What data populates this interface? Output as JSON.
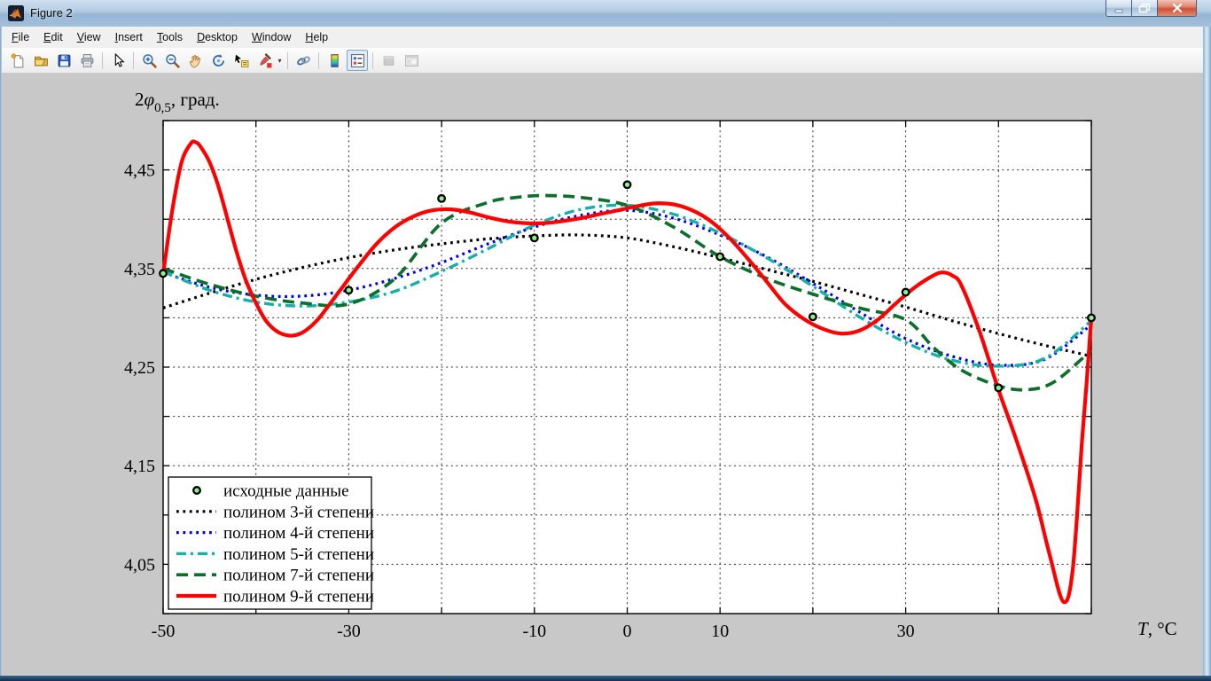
{
  "window": {
    "title": "Figure 2",
    "controls": {
      "minimize": "minimize",
      "restore": "restore-down",
      "close": "close"
    }
  },
  "menu": {
    "items": [
      "File",
      "Edit",
      "View",
      "Insert",
      "Tools",
      "Desktop",
      "Window",
      "Help"
    ]
  },
  "toolbar": {
    "icons": [
      "new-figure",
      "open-file",
      "save-figure",
      "print-figure",
      "edit-plot-cursor",
      "zoom-in",
      "zoom-out",
      "pan",
      "rotate-3d",
      "data-cursor",
      "brush-data",
      "link-plot",
      "insert-colorbar",
      "insert-legend",
      "hide-plot-tools",
      "show-plot-tools"
    ],
    "pressed": "insert-legend",
    "disabled": [
      "hide-plot-tools",
      "show-plot-tools"
    ]
  },
  "colors": {
    "figure_bg": "#c8c8c8",
    "plot_bg": "#ffffff",
    "titlebar": "#a9c4de"
  },
  "chart_data": {
    "type": "line",
    "title": "",
    "ylabel": {
      "base": "2",
      "symbol": "φ",
      "sub": "0,5",
      "rest": ", град."
    },
    "xlabel": {
      "symbol": "T",
      "rest": ", °C"
    },
    "xlim": [
      -50,
      50
    ],
    "ylim": [
      4.0,
      4.5
    ],
    "grid": true,
    "x_ticks": {
      "step": 10,
      "labels": [
        {
          "v": -50,
          "t": "-50"
        },
        {
          "v": -30,
          "t": "-30"
        },
        {
          "v": -10,
          "t": "-10"
        },
        {
          "v": 0,
          "t": "0"
        },
        {
          "v": 10,
          "t": "10"
        },
        {
          "v": 30,
          "t": "30"
        }
      ]
    },
    "y_ticks": {
      "step": 0.05,
      "labels": [
        {
          "v": 4.45,
          "t": "4,45"
        },
        {
          "v": 4.35,
          "t": "4,35"
        },
        {
          "v": 4.25,
          "t": "4,25"
        },
        {
          "v": 4.15,
          "t": "4,15"
        },
        {
          "v": 4.05,
          "t": "4,05"
        }
      ]
    },
    "legend_position": "southwest",
    "series": [
      {
        "name": "исходные данные",
        "type": "scatter",
        "color": "#000000",
        "face": "#8df08d",
        "style": "marker",
        "x": [
          -50,
          -30,
          -20,
          -10,
          0,
          10,
          20,
          30,
          40,
          50
        ],
        "y": [
          4.345,
          4.328,
          4.421,
          4.381,
          4.435,
          4.362,
          4.301,
          4.326,
          4.229,
          4.3
        ]
      },
      {
        "name": "полином 3-й степени",
        "type": "line",
        "color": "#000000",
        "style": "dotted",
        "x": [
          -50,
          -45,
          -40,
          -35,
          -30,
          -25,
          -20,
          -15,
          -10,
          -5,
          0,
          5,
          10,
          15,
          20,
          25,
          30,
          35,
          40,
          45,
          50
        ],
        "y": [
          4.31,
          4.325,
          4.339,
          4.351,
          4.361,
          4.369,
          4.375,
          4.38,
          4.383,
          4.384,
          4.381,
          4.372,
          4.361,
          4.349,
          4.337,
          4.324,
          4.311,
          4.297,
          4.284,
          4.272,
          4.261
        ]
      },
      {
        "name": "полином 4-й степени",
        "type": "line",
        "color": "#0000ee",
        "style": "dotted",
        "x": [
          -50,
          -45,
          -40,
          -35,
          -30,
          -25,
          -20,
          -15,
          -10,
          -5,
          0,
          5,
          10,
          15,
          20,
          25,
          30,
          35,
          40,
          45,
          50
        ],
        "y": [
          4.346,
          4.331,
          4.323,
          4.322,
          4.328,
          4.34,
          4.356,
          4.375,
          4.392,
          4.404,
          4.409,
          4.401,
          4.384,
          4.362,
          4.335,
          4.306,
          4.279,
          4.261,
          4.252,
          4.258,
          4.293
        ]
      },
      {
        "name": "полином 5-й степени",
        "type": "line",
        "color": "#17b0a8",
        "style": "dashdot",
        "x": [
          -50,
          -45,
          -40,
          -35,
          -30,
          -25,
          -20,
          -15,
          -10,
          -5,
          0,
          5,
          10,
          15,
          20,
          25,
          30,
          35,
          40,
          45,
          50
        ],
        "y": [
          4.347,
          4.328,
          4.316,
          4.312,
          4.316,
          4.327,
          4.347,
          4.37,
          4.394,
          4.41,
          4.414,
          4.405,
          4.386,
          4.361,
          4.332,
          4.301,
          4.275,
          4.257,
          4.251,
          4.259,
          4.297
        ]
      },
      {
        "name": "полином 7-й степени",
        "type": "line",
        "color": "#0e6f2d",
        "style": "dashed",
        "x": [
          -50,
          -45,
          -40,
          -35,
          -30,
          -25,
          -20,
          -15,
          -12,
          -9,
          -5,
          0,
          5,
          10,
          15,
          20,
          25,
          30,
          33,
          36,
          40,
          43,
          46,
          50
        ],
        "y": [
          4.35,
          4.334,
          4.322,
          4.315,
          4.314,
          4.34,
          4.396,
          4.417,
          4.422,
          4.424,
          4.422,
          4.414,
          4.392,
          4.362,
          4.34,
          4.324,
          4.31,
          4.298,
          4.27,
          4.247,
          4.231,
          4.227,
          4.235,
          4.267
        ]
      },
      {
        "name": "полином 9-й степени",
        "type": "line",
        "color": "#ff0000",
        "style": "solid",
        "x": [
          -50,
          -49,
          -48,
          -47,
          -46.5,
          -46,
          -45,
          -44,
          -43,
          -42,
          -41,
          -40,
          -39,
          -38,
          -37,
          -36,
          -35,
          -34,
          -33,
          -31,
          -29,
          -27,
          -25,
          -23,
          -21,
          -19,
          -17,
          -15,
          -13,
          -11,
          -9,
          -7,
          -5,
          -3,
          -1,
          1,
          3,
          5,
          7,
          9,
          11,
          13,
          15,
          17,
          19,
          21,
          23,
          25,
          27,
          29,
          31,
          33,
          34,
          35,
          36,
          38,
          40,
          42,
          44,
          45.5,
          47,
          48,
          49,
          49.5,
          50
        ],
        "y": [
          4.344,
          4.41,
          4.458,
          4.477,
          4.478,
          4.474,
          4.458,
          4.432,
          4.398,
          4.364,
          4.336,
          4.315,
          4.298,
          4.288,
          4.283,
          4.282,
          4.285,
          4.292,
          4.302,
          4.327,
          4.352,
          4.375,
          4.392,
          4.403,
          4.409,
          4.41,
          4.407,
          4.402,
          4.398,
          4.396,
          4.396,
          4.398,
          4.401,
          4.405,
          4.409,
          4.413,
          4.416,
          4.415,
          4.409,
          4.398,
          4.381,
          4.36,
          4.337,
          4.314,
          4.299,
          4.289,
          4.284,
          4.287,
          4.298,
          4.315,
          4.331,
          4.343,
          4.346,
          4.343,
          4.333,
          4.285,
          4.227,
          4.174,
          4.116,
          4.06,
          4.012,
          4.045,
          4.175,
          4.235,
          4.3
        ]
      }
    ]
  }
}
